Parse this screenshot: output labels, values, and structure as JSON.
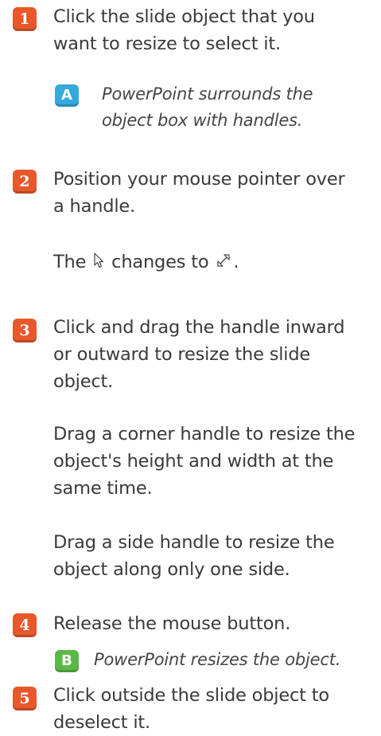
{
  "accent_colors": {
    "step_badge": "#e8582b",
    "callout_a": "#33a9dd",
    "callout_b": "#5db84a"
  },
  "steps": [
    {
      "number": "1",
      "lines": [
        "Click the slide object that you",
        "want to resize to select it."
      ]
    },
    {
      "number": "2",
      "lines": [
        "Position your mouse pointer over",
        "a handle."
      ]
    },
    {
      "number": "3",
      "lines": [
        "Click and drag the handle inward",
        "or outward to resize the slide",
        "object."
      ]
    },
    {
      "number": "4",
      "lines": [
        "Release the mouse button."
      ]
    },
    {
      "number": "5",
      "lines": [
        "Click outside the slide object to",
        "deselect it."
      ]
    }
  ],
  "callouts": {
    "a": {
      "letter": "A",
      "lines": [
        "PowerPoint surrounds the",
        "object box with handles."
      ]
    },
    "b": {
      "letter": "B",
      "lines": [
        "PowerPoint resizes the object."
      ]
    }
  },
  "step2_note": {
    "before": "The",
    "middle": "changes to",
    "after": ".",
    "icon_from": "arrow-pointer-icon",
    "icon_to": "diagonal-resize-icon"
  },
  "step3_notes": [
    {
      "lines": [
        "Drag a corner handle to resize the",
        "object's height and width at the",
        "same time."
      ]
    },
    {
      "lines": [
        "Drag a side handle to resize the",
        "object along only one side."
      ]
    }
  ]
}
